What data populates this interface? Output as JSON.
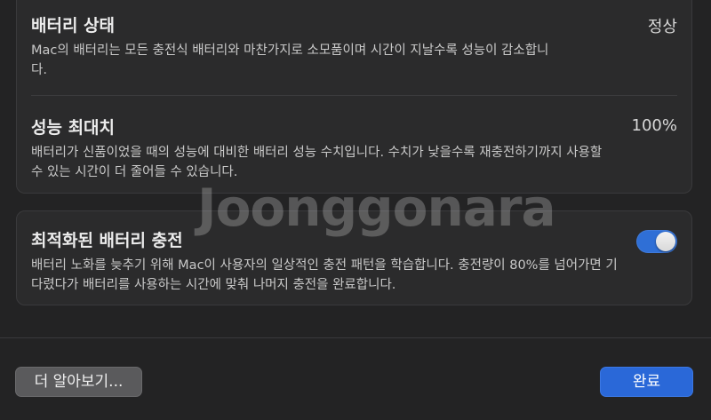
{
  "battery_status": {
    "title": "배터리 상태",
    "value": "정상",
    "description": "Mac의 배터리는 모든 충전식 배터리와 마찬가지로 소모품이며 시간이 지날수록 성능이 감소합니다."
  },
  "max_capacity": {
    "title": "성능 최대치",
    "value": "100%",
    "description": "배터리가 신품이었을 때의 성능에 대비한 배터리 성능 수치입니다. 수치가 낮을수록 재충전하기까지 사용할 수 있는 시간이 더 줄어들 수 있습니다."
  },
  "optimized_charging": {
    "title": "최적화된 배터리 충전",
    "description": "배터리 노화를 늦추기 위해 Mac이 사용자의 일상적인 충전 패턴을 학습합니다. 충전량이 80%를 넘어가면 기다렸다가 배터리를 사용하는 시간에 맞춰 나머지 충전을 완료합니다.",
    "enabled": true
  },
  "footer": {
    "learn_more_label": "더 알아보기...",
    "done_label": "완료"
  },
  "watermark": "Joonggonara",
  "colors": {
    "accent": "#2a68d8",
    "background": "#232324",
    "panel": "#2b2b2c"
  }
}
